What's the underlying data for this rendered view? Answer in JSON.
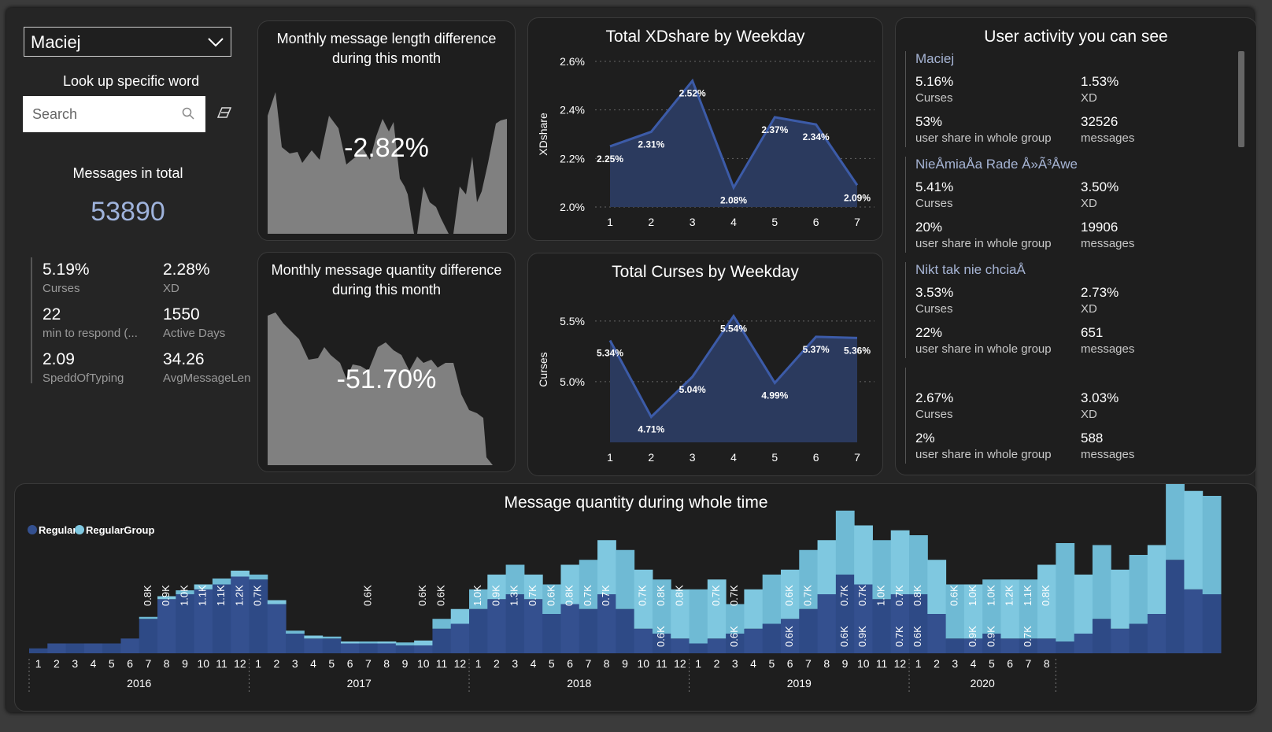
{
  "user_select": {
    "value": "Maciej"
  },
  "lookup": {
    "title": "Look up specific word",
    "placeholder": "Search"
  },
  "messages_total": {
    "title": "Messages in total",
    "value": "53890"
  },
  "stats": [
    {
      "value": "5.19%",
      "label": "Curses"
    },
    {
      "value": "2.28%",
      "label": "XD"
    },
    {
      "value": "22",
      "label": "min to respond (..."
    },
    {
      "value": "1550",
      "label": "Active Days"
    },
    {
      "value": "2.09",
      "label": "SpeddOfTyping"
    },
    {
      "value": "34.26",
      "label": "AvgMessageLen"
    }
  ],
  "length_diff": {
    "title_line1": "Monthly message length difference",
    "title_line2": "during this month",
    "value": "-2.82%"
  },
  "quantity_diff": {
    "title_line1": "Monthly message quantity difference",
    "title_line2": "during this month",
    "value": "-51.70%"
  },
  "user_activity": {
    "title": "User activity you can see",
    "users": [
      {
        "name": "Maciej",
        "curses": "5.16%",
        "curses_label": "Curses",
        "xd": "1.53%",
        "xd_label": "XD",
        "share": "53%",
        "share_label": "user share in whole group",
        "messages": "32526",
        "messages_label": "messages"
      },
      {
        "name": "NieÅmiaÅa Rade Å»Ã³Åwe",
        "curses": "5.41%",
        "curses_label": "Curses",
        "xd": "3.50%",
        "xd_label": "XD",
        "share": "20%",
        "share_label": "user share in whole group",
        "messages": "19906",
        "messages_label": "messages"
      },
      {
        "name": "Nikt tak nie chciaÅ",
        "curses": "3.53%",
        "curses_label": "Curses",
        "xd": "2.73%",
        "xd_label": "XD",
        "share": "22%",
        "share_label": "user share in whole group",
        "messages": "651",
        "messages_label": "messages"
      },
      {
        "name": "",
        "curses": "2.67%",
        "curses_label": "Curses",
        "xd": "3.03%",
        "xd_label": "XD",
        "share": "2%",
        "share_label": "user share in whole group",
        "messages": "588",
        "messages_label": "messages"
      }
    ]
  },
  "colors": {
    "regular": "#34508f",
    "regular_group": "#7fc8e0",
    "area_fill": "#2b3a5e",
    "area_line": "#3c5ba8",
    "sparkline": "#808080"
  },
  "chart_data": [
    {
      "type": "area",
      "title": "Total XDshare by Weekday",
      "ylabel": "XDshare",
      "x": [
        1,
        2,
        3,
        4,
        5,
        6,
        7
      ],
      "values": [
        2.25,
        2.31,
        2.52,
        2.08,
        2.37,
        2.34,
        2.09
      ],
      "data_labels": [
        "2.25%",
        "2.31%",
        "2.52%",
        "2.08%",
        "2.37%",
        "2.34%",
        "2.09%"
      ],
      "y_ticks": [
        "2.0%",
        "2.2%",
        "2.4%",
        "2.6%"
      ],
      "ylim": [
        2.0,
        2.6
      ]
    },
    {
      "type": "area",
      "title": "Total Curses by Weekday",
      "ylabel": "Curses",
      "x": [
        1,
        2,
        3,
        4,
        5,
        6,
        7
      ],
      "values": [
        5.34,
        4.71,
        5.04,
        5.54,
        4.99,
        5.37,
        5.36
      ],
      "data_labels": [
        "5.34%",
        "4.71%",
        "5.04%",
        "5.54%",
        "4.99%",
        "5.37%",
        "5.36%"
      ],
      "y_ticks": [
        "5.0%",
        "5.5%"
      ],
      "ylim": [
        4.5,
        5.7
      ]
    },
    {
      "type": "bar",
      "title": "Message quantity during whole time",
      "legend": [
        "Regular",
        "RegularGroup"
      ],
      "years": [
        "2016",
        "2017",
        "2018",
        "2019",
        "2020"
      ],
      "months_per_year": [
        12,
        12,
        12,
        12,
        8
      ],
      "regular": [
        0.05,
        0.1,
        0.1,
        0.1,
        0.1,
        0.15,
        0.35,
        0.55,
        0.6,
        0.65,
        0.7,
        0.78,
        0.75,
        0.5,
        0.2,
        0.15,
        0.15,
        0.1,
        0.1,
        0.1,
        0.08,
        0.08,
        0.25,
        0.3,
        0.45,
        0.55,
        0.6,
        0.55,
        0.4,
        0.5,
        0.45,
        0.6,
        0.45,
        0.25,
        0.2,
        0.15,
        0.1,
        0.15,
        0.2,
        0.25,
        0.3,
        0.35,
        0.45,
        0.6,
        0.8,
        0.7,
        0.55,
        0.6,
        0.6,
        0.4,
        0.15,
        0.15,
        0.2,
        0.15,
        0.15,
        0.15,
        0.12,
        0.2,
        0.35,
        0.25,
        0.3,
        0.4,
        0.95,
        0.65,
        0.6
      ],
      "group": [
        0,
        0,
        0,
        0,
        0,
        0,
        0.02,
        0.03,
        0.04,
        0.05,
        0.06,
        0.06,
        0.05,
        0.04,
        0.03,
        0.03,
        0.02,
        0.02,
        0.02,
        0.02,
        0.03,
        0.05,
        0.1,
        0.15,
        0.2,
        0.25,
        0.3,
        0.25,
        0.3,
        0.4,
        0.5,
        0.55,
        0.6,
        0.6,
        0.55,
        0.5,
        0.55,
        0.6,
        0.3,
        0.4,
        0.5,
        0.5,
        0.6,
        0.55,
        0.65,
        0.6,
        0.6,
        0.65,
        0.6,
        0.55,
        0.55,
        0.55,
        0.55,
        0.6,
        0.6,
        0.75,
        1.0,
        0.6,
        0.75,
        0.6,
        0.7,
        0.7,
        1.0,
        1.0,
        1.0,
        0.9,
        0.65
      ],
      "bar_labels": [
        {
          "i": 6,
          "text": "0.8K"
        },
        {
          "i": 7,
          "text": "0.9K"
        },
        {
          "i": 8,
          "text": "1.0K"
        },
        {
          "i": 9,
          "text": "1.1K"
        },
        {
          "i": 10,
          "text": "1.1K"
        },
        {
          "i": 11,
          "text": "1.2K"
        },
        {
          "i": 12,
          "text": "0.7K"
        },
        {
          "i": 18,
          "text": "0.6K"
        },
        {
          "i": 21,
          "text": "0.6K"
        },
        {
          "i": 22,
          "text": "0.6K"
        },
        {
          "i": 24,
          "text": "1.0K"
        },
        {
          "i": 25,
          "text": "0.9K"
        },
        {
          "i": 26,
          "text": "1.3K"
        },
        {
          "i": 27,
          "text": "0.7K"
        },
        {
          "i": 28,
          "text": "0.6K"
        },
        {
          "i": 29,
          "text": "0.8K"
        },
        {
          "i": 30,
          "text": "0.7K"
        },
        {
          "i": 31,
          "text": "0.7K"
        },
        {
          "i": 33,
          "text": "0.7K"
        },
        {
          "i": 34,
          "text": "0.8K"
        },
        {
          "i": 34,
          "text": "0.6K"
        },
        {
          "i": 35,
          "text": "0.8K"
        },
        {
          "i": 37,
          "text": "0.7K"
        },
        {
          "i": 38,
          "text": "0.7K"
        },
        {
          "i": 38,
          "text": "0.6K"
        },
        {
          "i": 41,
          "text": "0.6K"
        },
        {
          "i": 41,
          "text": "0.6K"
        },
        {
          "i": 42,
          "text": "0.7K"
        },
        {
          "i": 44,
          "text": "0.7K"
        },
        {
          "i": 44,
          "text": "0.6K"
        },
        {
          "i": 45,
          "text": "0.7K"
        },
        {
          "i": 45,
          "text": "0.9K"
        },
        {
          "i": 46,
          "text": "1.0K"
        },
        {
          "i": 47,
          "text": "0.7K"
        },
        {
          "i": 47,
          "text": "0.7K"
        },
        {
          "i": 48,
          "text": "0.8K"
        },
        {
          "i": 48,
          "text": "0.6K"
        },
        {
          "i": 50,
          "text": "0.6K"
        },
        {
          "i": 51,
          "text": "1.0K"
        },
        {
          "i": 51,
          "text": "0.9K"
        },
        {
          "i": 52,
          "text": "1.0K"
        },
        {
          "i": 52,
          "text": "0.9K"
        },
        {
          "i": 53,
          "text": "1.2K"
        },
        {
          "i": 54,
          "text": "1.1K"
        },
        {
          "i": 54,
          "text": "0.7K"
        },
        {
          "i": 55,
          "text": "0.8K"
        }
      ]
    }
  ]
}
